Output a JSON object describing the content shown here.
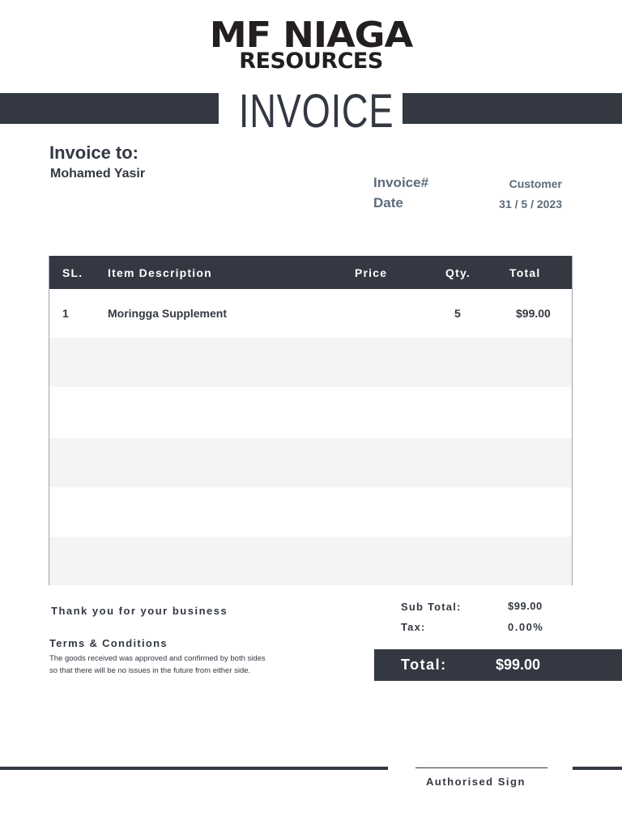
{
  "company": {
    "name_line1": "MF NIAGA",
    "name_line2": "RESOURCES"
  },
  "title": "INVOICE",
  "bill_to": {
    "heading": "Invoice to:",
    "name": "Mohamed Yasir"
  },
  "meta": {
    "invoice_label": "Invoice#",
    "invoice_value": "Customer",
    "date_label": "Date",
    "date_value": "31 / 5 / 2023"
  },
  "table": {
    "headers": [
      "SL.",
      "Item Description",
      "Price",
      "Qty.",
      "Total"
    ],
    "rows": [
      {
        "sl": "1",
        "description": "Moringga Supplement",
        "price": "",
        "qty": "5",
        "total": "$99.00"
      }
    ]
  },
  "footer": {
    "thanks": "Thank you for your business",
    "terms_heading": "Terms & Conditions",
    "terms_line1": "The goods received was approved and confirmed by both sides",
    "terms_line2": "so that there will be no issues in the future from either side.",
    "subtotal_label": "Sub Total:",
    "subtotal_value": "$99.00",
    "tax_label": "Tax:",
    "tax_value": "0.00%",
    "total_label": "Total:",
    "total_value": "$99.00",
    "sign_label": "Authorised Sign"
  },
  "colors": {
    "dark": "#333842",
    "meta": "#5b6b7a"
  }
}
